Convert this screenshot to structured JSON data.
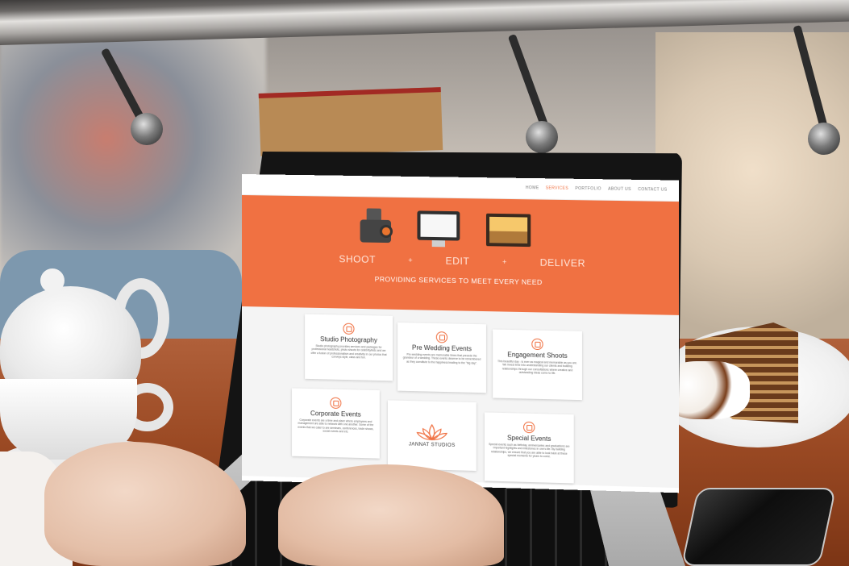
{
  "colors": {
    "brand_orange": "#f07142",
    "nav_text": "#7c7c7c",
    "card_background": "#ffffff"
  },
  "nav": {
    "items": [
      {
        "label": "HOME",
        "active": false
      },
      {
        "label": "SERVICES",
        "active": true
      },
      {
        "label": "PORTFOLIO",
        "active": false
      },
      {
        "label": "ABOUT US",
        "active": false
      },
      {
        "label": "CONTACT US",
        "active": false
      }
    ]
  },
  "hero": {
    "icons": [
      "camera-icon",
      "monitor-icon",
      "picture-frame-icon"
    ],
    "steps": [
      "SHOOT",
      "+",
      "EDIT",
      "+",
      "DELIVER"
    ],
    "tagline": "PROVIDING SERVICES TO MEET EVERY NEED"
  },
  "services": [
    {
      "icon": "camera-icon",
      "title": "Studio Photography",
      "body": "Studio photography provides services and packages for professional headshots, photo shoots for celebrity/kids and we offer a fusion of professionalism and creativity in our photos that conveys style, class and fun."
    },
    {
      "icon": "rings-icon",
      "title": "Pre Wedding Events",
      "body": "Pre-wedding events are memorable times that precede the grandeur of a wedding. These events deserve to be remembered as they constitute to the happiness leading to the \"big day\"."
    },
    {
      "icon": "heart-camera-icon",
      "title": "Engagement Shoots",
      "body": "This beautiful day - is ever as magical and memorable as you are. We invest time into understanding our clients and building relationships through our consultations where creative and outstanding ideas come to life."
    },
    {
      "icon": "briefcase-icon",
      "title": "Corporate Events",
      "body": "Corporate events are a time and place where employees and management are able to network with one another. Some of the events that we cater to are seminars, conferences, trade shows, social events and etc."
    },
    {
      "icon": "calendar-icon",
      "title": "Special Events",
      "body": "Special events such as birthday, anniversaries and graduations are important highlights and milestones in one's life. By building relationships, we ensure that you are able to look back at these special moments for years to come."
    }
  ],
  "logo": {
    "text": "JANNAT STUDIOS"
  }
}
